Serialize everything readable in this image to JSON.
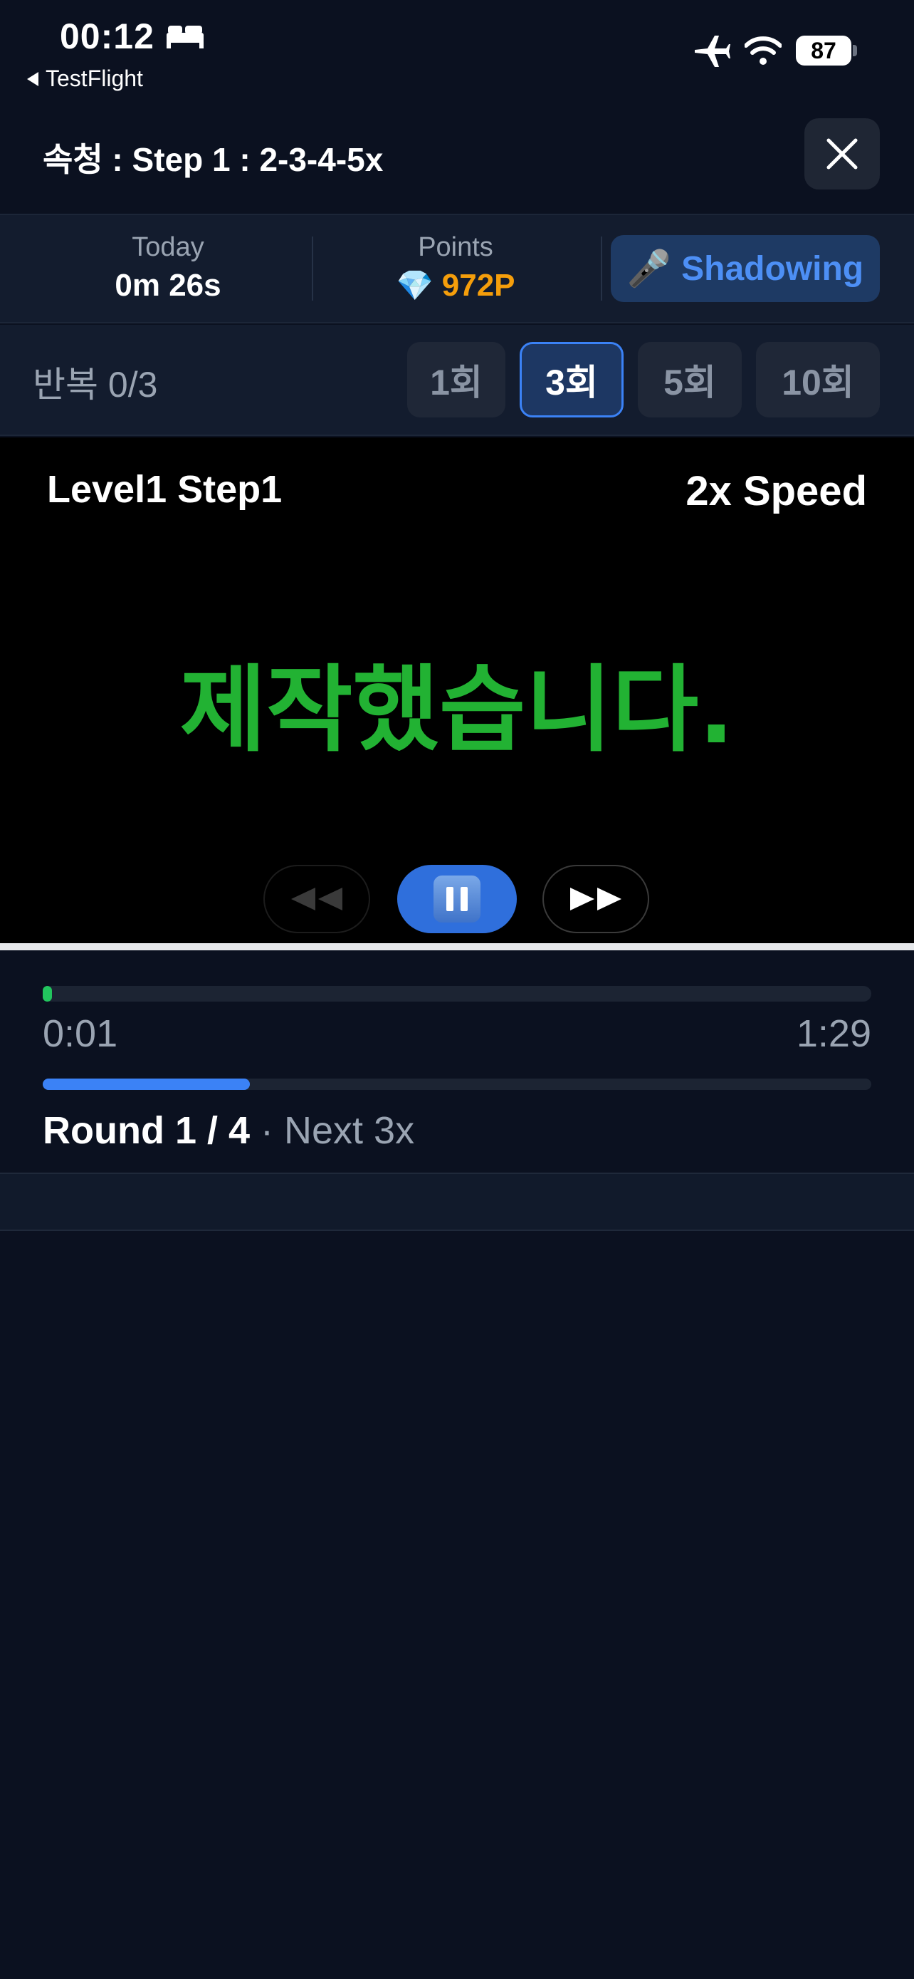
{
  "status_bar": {
    "time": "00:12",
    "back_app": "TestFlight",
    "battery": "87",
    "icons": [
      "bed-icon",
      "airplane-icon",
      "wifi-icon"
    ]
  },
  "header": {
    "title": "속청 : Step 1 : 2-3-4-5x",
    "close_icon": "close-icon"
  },
  "stats": {
    "today_label": "Today",
    "today_value": "0m 26s",
    "points_label": "Points",
    "points_value": "972P",
    "points_icon": "💎",
    "shadowing_icon": "🎤",
    "shadowing_label": "Shadowing"
  },
  "repeat": {
    "label": "반복 0/3",
    "options": [
      "1회",
      "3회",
      "5회",
      "10회"
    ],
    "selected": "3회"
  },
  "player": {
    "level": "Level1 Step1",
    "speed": "2x Speed",
    "sentence": "제작했습니다.",
    "controls": [
      "rewind-icon",
      "pause-icon",
      "fast-forward-icon"
    ]
  },
  "progress": {
    "current": "0:01",
    "total": "1:29",
    "played_fraction": 0.011,
    "round_fraction": 0.25,
    "round_text": "Round 1 / 4",
    "round_next": " · Next 3x"
  },
  "colors": {
    "background": "#0b1120",
    "accent": "#3b82f6",
    "sentence": "#22b233",
    "points": "#f59e0b",
    "progress": "#22c55e"
  }
}
